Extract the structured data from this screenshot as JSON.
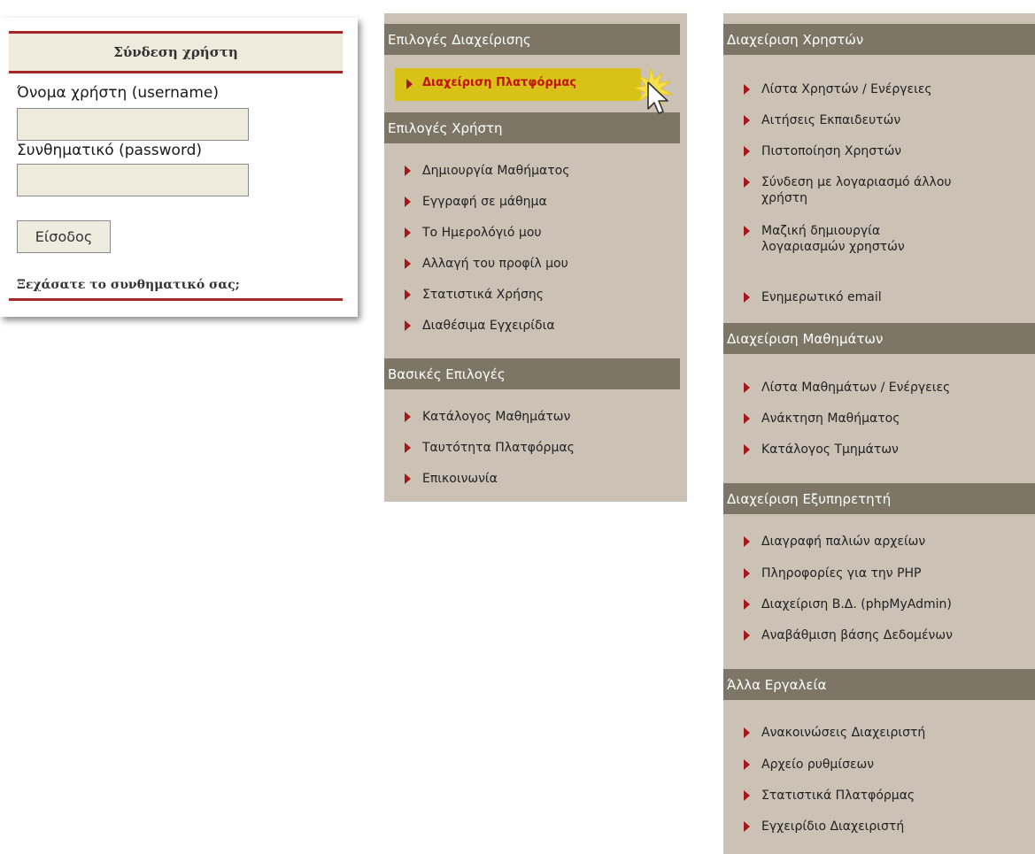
{
  "login": {
    "title": "Σύνδεση χρήστη",
    "username_label": "Όνομα χρήστη (username)",
    "username_value": "",
    "password_label": "Συνθηματικό (password)",
    "password_value": "",
    "login_button": "Είσοδος",
    "forgot_password": "Ξεχάσατε το συνθηματικό σας;"
  },
  "middle_menu": {
    "admin_section": "Επιλογές Διαχείρισης",
    "admin_item": "Διαχείριση Πλατφόρμας",
    "user_section": "Επιλογές Χρήστη",
    "user_items": [
      "Δημιουργία Μαθήματος",
      "Εγγραφή σε μάθημα",
      "Το Ημερολόγιό μου",
      "Αλλαγή του προφίλ μου",
      "Στατιστικά Χρήσης",
      "Διαθέσιμα Εγχειρίδια"
    ],
    "basic_section": "Βασικές Επιλογές",
    "basic_items": [
      "Κατάλογος Μαθημάτων",
      "Ταυτότητα Πλατφόρμας",
      "Επικοινωνία"
    ]
  },
  "right_menu": {
    "users_section": "Διαχείριση Χρηστών",
    "users_items": [
      "Λίστα Χρηστών / Ενέργειες",
      "Αιτήσεις Εκπαιδευτών",
      "Πιστοποίηση Χρηστών",
      "Σύνδεση με λογαριασμό άλλου",
      "χρήστη",
      "Μαζική δημιουργία",
      "λογαριασμών χρηστών",
      "Ενημερωτικό email"
    ],
    "courses_section": "Διαχείριση Μαθημάτων",
    "courses_items": [
      "Λίστα Μαθημάτων / Ενέργειες",
      "Ανάκτηση Μαθήματος",
      "Κατάλογος Τμημάτων"
    ],
    "server_section": "Διαχείριση Εξυπηρετητή",
    "server_items": [
      "Διαγραφή παλιών αρχείων",
      "Πληροφορίες για την PHP",
      "Διαχείριση Β.Δ. (phpMyAdmin)",
      "Αναβάθμιση βάσης Δεδομένων"
    ],
    "tools_section": "Άλλα Εργαλεία",
    "tools_items": [
      "Ανακοινώσεις Διαχειριστή",
      "Αρχείο ρυθμίσεων",
      "Στατιστικά Πλατφόρμας",
      "Εγχειρίδιο Διαχειριστή"
    ]
  },
  "colors": {
    "accent_red": "#a32727",
    "menu_background": "#cbc2b5",
    "section_header": "#7d7565",
    "highlight": "#d9c217",
    "login_field": "#efebdc"
  }
}
